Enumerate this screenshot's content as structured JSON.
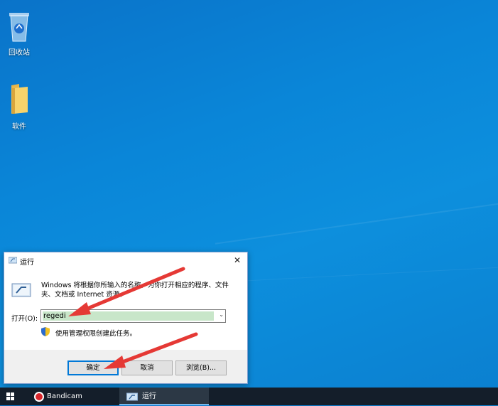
{
  "desktop": {
    "icons": [
      {
        "label": "回收站",
        "icon": "recycle-bin-icon"
      },
      {
        "label": "软件",
        "icon": "folder-icon"
      }
    ]
  },
  "run_dialog": {
    "title": "运行",
    "close_glyph": "✕",
    "description": "Windows 将根据你所输入的名称，为你打开相应的程序、文件夹、文档或 Internet 资源。",
    "open_label": "打开(O):",
    "input_value": "regedi",
    "admin_note": "使用管理权限创建此任务。",
    "buttons": {
      "ok": "确定",
      "cancel": "取消",
      "browse": "浏览(B)..."
    }
  },
  "taskbar": {
    "items": [
      {
        "label": "Bandicam",
        "icon": "bandicam-icon"
      },
      {
        "label": "运行",
        "icon": "run-icon",
        "active": true
      }
    ]
  },
  "colors": {
    "desktop": "#0a86d8",
    "taskbar": "#141e2a",
    "input_highlight": "#c8e6c9",
    "arrow": "#e53935"
  }
}
